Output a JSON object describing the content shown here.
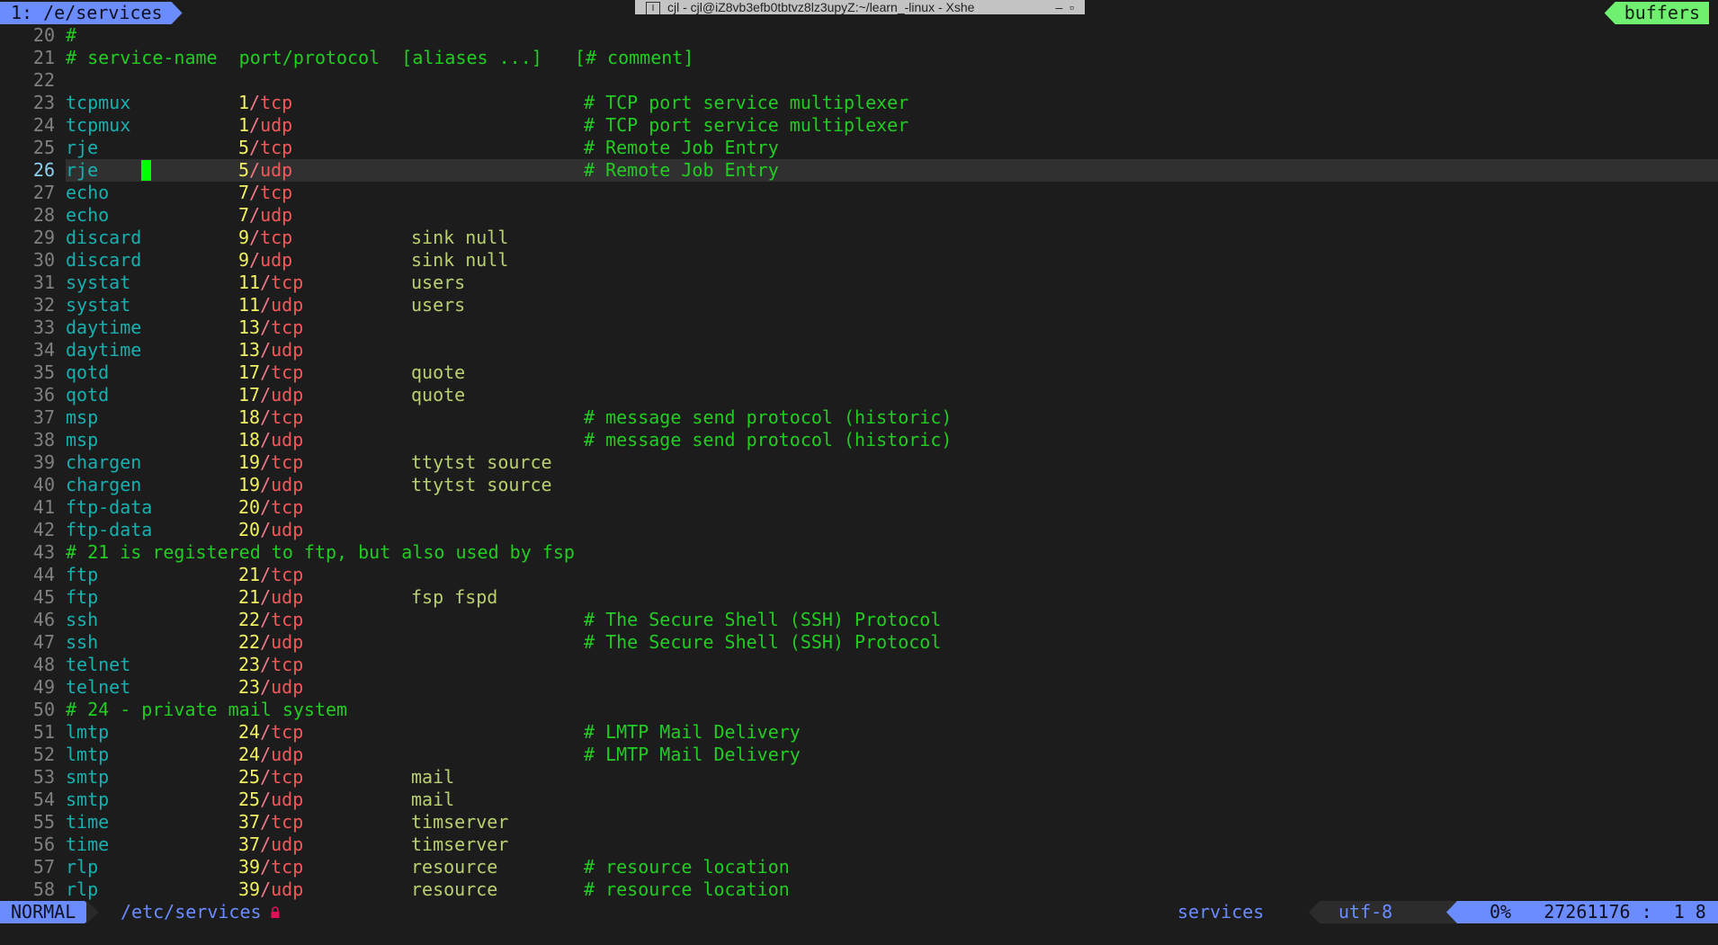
{
  "tabline": {
    "tab_label": "1: /e/services",
    "buffers_label": "buffers"
  },
  "window_title": "cjl - cjl@iZ8vb3efb0tbtvz8lz3upyZ:~/learn_-linux - Xshe",
  "colors": {
    "tab_bg": "#6b8cff",
    "buffers_bg": "#70f070",
    "service": "#17b0b0",
    "port": "#f0f060",
    "protocol": "#f05a5a",
    "alias": "#b8d070",
    "comment": "#22cc22",
    "cursor": "#00ff00",
    "background": "#1c1c1c"
  },
  "cursor_line": 26,
  "lines": [
    {
      "n": "20",
      "text": "#"
    },
    {
      "n": "21",
      "text": "# service-name  port/protocol  [aliases ...]   [# comment]"
    },
    {
      "n": "22",
      "text": ""
    },
    {
      "n": "23",
      "svc": "tcpmux",
      "port": "1",
      "proto": "tcp",
      "alias": "",
      "cmt": "# TCP port service multiplexer"
    },
    {
      "n": "24",
      "svc": "tcpmux",
      "port": "1",
      "proto": "udp",
      "alias": "",
      "cmt": "# TCP port service multiplexer"
    },
    {
      "n": "25",
      "svc": "rje",
      "port": "5",
      "proto": "tcp",
      "alias": "",
      "cmt": "# Remote Job Entry"
    },
    {
      "n": "26",
      "svc": "rje",
      "port": "5",
      "proto": "udp",
      "alias": "",
      "cmt": "# Remote Job Entry"
    },
    {
      "n": "27",
      "svc": "echo",
      "port": "7",
      "proto": "tcp",
      "alias": "",
      "cmt": ""
    },
    {
      "n": "28",
      "svc": "echo",
      "port": "7",
      "proto": "udp",
      "alias": "",
      "cmt": ""
    },
    {
      "n": "29",
      "svc": "discard",
      "port": "9",
      "proto": "tcp",
      "alias": "sink null",
      "cmt": ""
    },
    {
      "n": "30",
      "svc": "discard",
      "port": "9",
      "proto": "udp",
      "alias": "sink null",
      "cmt": ""
    },
    {
      "n": "31",
      "svc": "systat",
      "port": "11",
      "proto": "tcp",
      "alias": "users",
      "cmt": ""
    },
    {
      "n": "32",
      "svc": "systat",
      "port": "11",
      "proto": "udp",
      "alias": "users",
      "cmt": ""
    },
    {
      "n": "33",
      "svc": "daytime",
      "port": "13",
      "proto": "tcp",
      "alias": "",
      "cmt": ""
    },
    {
      "n": "34",
      "svc": "daytime",
      "port": "13",
      "proto": "udp",
      "alias": "",
      "cmt": ""
    },
    {
      "n": "35",
      "svc": "qotd",
      "port": "17",
      "proto": "tcp",
      "alias": "quote",
      "cmt": ""
    },
    {
      "n": "36",
      "svc": "qotd",
      "port": "17",
      "proto": "udp",
      "alias": "quote",
      "cmt": ""
    },
    {
      "n": "37",
      "svc": "msp",
      "port": "18",
      "proto": "tcp",
      "alias": "",
      "cmt": "# message send protocol (historic)"
    },
    {
      "n": "38",
      "svc": "msp",
      "port": "18",
      "proto": "udp",
      "alias": "",
      "cmt": "# message send protocol (historic)"
    },
    {
      "n": "39",
      "svc": "chargen",
      "port": "19",
      "proto": "tcp",
      "alias": "ttytst source",
      "cmt": ""
    },
    {
      "n": "40",
      "svc": "chargen",
      "port": "19",
      "proto": "udp",
      "alias": "ttytst source",
      "cmt": ""
    },
    {
      "n": "41",
      "svc": "ftp-data",
      "port": "20",
      "proto": "tcp",
      "alias": "",
      "cmt": ""
    },
    {
      "n": "42",
      "svc": "ftp-data",
      "port": "20",
      "proto": "udp",
      "alias": "",
      "cmt": ""
    },
    {
      "n": "43",
      "text": "# 21 is registered to ftp, but also used by fsp"
    },
    {
      "n": "44",
      "svc": "ftp",
      "port": "21",
      "proto": "tcp",
      "alias": "",
      "cmt": ""
    },
    {
      "n": "45",
      "svc": "ftp",
      "port": "21",
      "proto": "udp",
      "alias": "fsp fspd",
      "cmt": ""
    },
    {
      "n": "46",
      "svc": "ssh",
      "port": "22",
      "proto": "tcp",
      "alias": "",
      "cmt": "# The Secure Shell (SSH) Protocol"
    },
    {
      "n": "47",
      "svc": "ssh",
      "port": "22",
      "proto": "udp",
      "alias": "",
      "cmt": "# The Secure Shell (SSH) Protocol"
    },
    {
      "n": "48",
      "svc": "telnet",
      "port": "23",
      "proto": "tcp",
      "alias": "",
      "cmt": ""
    },
    {
      "n": "49",
      "svc": "telnet",
      "port": "23",
      "proto": "udp",
      "alias": "",
      "cmt": ""
    },
    {
      "n": "50",
      "text": "# 24 - private mail system"
    },
    {
      "n": "51",
      "svc": "lmtp",
      "port": "24",
      "proto": "tcp",
      "alias": "",
      "cmt": "# LMTP Mail Delivery"
    },
    {
      "n": "52",
      "svc": "lmtp",
      "port": "24",
      "proto": "udp",
      "alias": "",
      "cmt": "# LMTP Mail Delivery"
    },
    {
      "n": "53",
      "svc": "smtp",
      "port": "25",
      "proto": "tcp",
      "alias": "mail",
      "cmt": ""
    },
    {
      "n": "54",
      "svc": "smtp",
      "port": "25",
      "proto": "udp",
      "alias": "mail",
      "cmt": ""
    },
    {
      "n": "55",
      "svc": "time",
      "port": "37",
      "proto": "tcp",
      "alias": "timserver",
      "cmt": ""
    },
    {
      "n": "56",
      "svc": "time",
      "port": "37",
      "proto": "udp",
      "alias": "timserver",
      "cmt": ""
    },
    {
      "n": "57",
      "svc": "rlp",
      "port": "39",
      "proto": "tcp",
      "alias": "resource",
      "cmt": "# resource location"
    },
    {
      "n": "58",
      "svc": "rlp",
      "port": "39",
      "proto": "udp",
      "alias": "resource",
      "cmt": "# resource location"
    }
  ],
  "statusline": {
    "mode": "NORMAL",
    "file": "/etc/services",
    "readonly_icon": "lock-icon",
    "filetype": "services",
    "encoding": "utf-8",
    "percent": "0%",
    "position": "27261176 :  1 8"
  }
}
